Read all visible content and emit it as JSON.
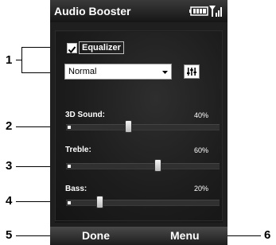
{
  "title_bar": {
    "title": "Audio Booster",
    "icons": [
      "battery-icon",
      "signal-icon"
    ]
  },
  "equalizer": {
    "checkbox_label": "Equalizer",
    "checked": true,
    "preset_value": "Normal",
    "settings_icon": "equalizer-settings-icon"
  },
  "sliders": [
    {
      "label": "3D Sound:",
      "value": "40%",
      "level": 0.4
    },
    {
      "label": "Treble:",
      "value": "60%",
      "level": 0.6
    },
    {
      "label": "Bass:",
      "value": "20%",
      "level": 0.2
    }
  ],
  "softkeys": {
    "left": "Done",
    "right": "Menu"
  },
  "callouts": [
    "1",
    "2",
    "3",
    "4",
    "5",
    "6"
  ],
  "colors": {
    "screen_bg": "#1f1f1f",
    "text": "#ffffff",
    "callout": "#000000"
  }
}
